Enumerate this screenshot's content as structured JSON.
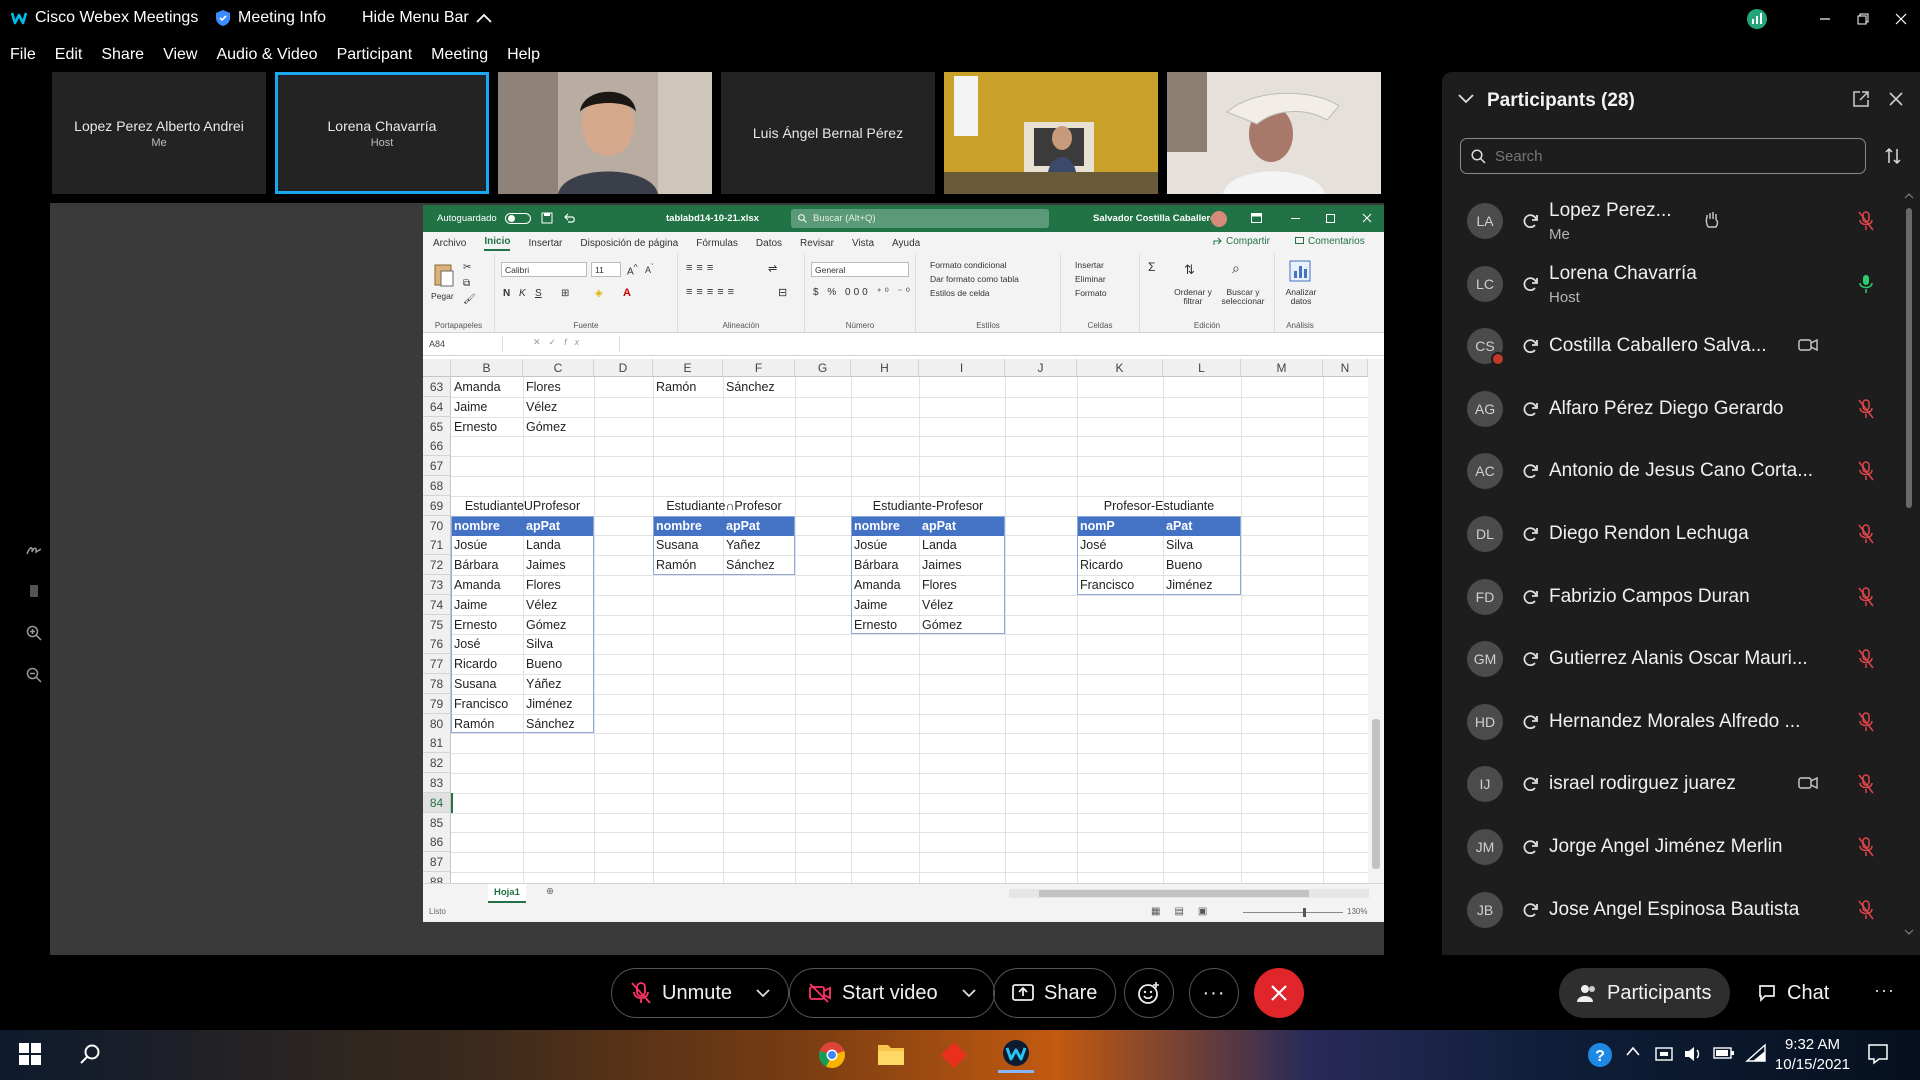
{
  "titlebar": {
    "app_name": "Cisco Webex Meetings",
    "meeting_info": "Meeting Info",
    "hide_menu": "Hide Menu Bar"
  },
  "menu": [
    "File",
    "Edit",
    "Share",
    "View",
    "Audio & Video",
    "Participant",
    "Meeting",
    "Help"
  ],
  "video_tiles": [
    {
      "name": "Lopez Perez Alberto Andrei",
      "sub": "Me"
    },
    {
      "name": "Lorena Chavarría",
      "sub": "Host"
    },
    {
      "name": "Luis Ángel Bernal Pérez",
      "sub": ""
    }
  ],
  "excel": {
    "autosave": "Autoguardado",
    "filename": "tablabd14-10-21.xlsx",
    "search": "Buscar (Alt+Q)",
    "user": "Salvador Costilla Caballero",
    "tabs": [
      "Archivo",
      "Inicio",
      "Insertar",
      "Disposición de página",
      "Fórmulas",
      "Datos",
      "Revisar",
      "Vista",
      "Ayuda"
    ],
    "share": "Compartir",
    "comments": "Comentarios",
    "ribbon": {
      "paste": "Pegar",
      "clipboard": "Portapapeles",
      "font_name": "Calibri",
      "font_size": "11",
      "font": "Fuente",
      "align": "Alineación",
      "num_format": "General",
      "number": "Número",
      "cond_format": "Formato condicional",
      "table_format": "Dar formato como tabla",
      "cell_styles": "Estilos de celda",
      "styles": "Estilos",
      "insert": "Insertar",
      "delete": "Eliminar",
      "format": "Formato",
      "cells": "Celdas",
      "sort": "Ordenar y filtrar",
      "find": "Buscar y seleccionar",
      "editing": "Edición",
      "analyze": "Analizar datos",
      "analysis": "Análisis"
    },
    "namebox": "A84",
    "columns": [
      "B",
      "C",
      "D",
      "E",
      "F",
      "G",
      "H",
      "I",
      "J",
      "K",
      "L",
      "M",
      "N"
    ],
    "rows": [
      "63",
      "64",
      "65",
      "66",
      "67",
      "68",
      "69",
      "70",
      "71",
      "72",
      "73",
      "74",
      "75",
      "76",
      "77",
      "78",
      "79",
      "80",
      "81",
      "82",
      "83",
      "84",
      "85",
      "86",
      "87",
      "88"
    ],
    "selected_row": "84",
    "top_block": [
      [
        "Amanda",
        "Flores"
      ],
      [
        "Jaime",
        "Vélez"
      ],
      [
        "Ernesto",
        "Gómez"
      ]
    ],
    "top_e": [
      "Ramón",
      "Sánchez"
    ],
    "table1": {
      "title": "EstudianteUProfesor",
      "headers": [
        "nombre",
        "apPat"
      ],
      "rows": [
        [
          "Josúe",
          "Landa"
        ],
        [
          "Bárbara",
          "Jaimes"
        ],
        [
          "Amanda",
          "Flores"
        ],
        [
          "Jaime",
          "Vélez"
        ],
        [
          "Ernesto",
          "Gómez"
        ],
        [
          "José",
          "Silva"
        ],
        [
          "Ricardo",
          "Bueno"
        ],
        [
          "Susana",
          "Yáñez"
        ],
        [
          "Francisco",
          "Jiménez"
        ],
        [
          "Ramón",
          "Sánchez"
        ]
      ]
    },
    "table2": {
      "title": "Estudiante∩Profesor",
      "headers": [
        "nombre",
        "apPat"
      ],
      "rows": [
        [
          "Susana",
          "Yañez"
        ],
        [
          "Ramón",
          "Sánchez"
        ]
      ]
    },
    "table3": {
      "title": "Estudiante-Profesor",
      "headers": [
        "nombre",
        "apPat"
      ],
      "rows": [
        [
          "Josúe",
          "Landa"
        ],
        [
          "Bárbara",
          "Jaimes"
        ],
        [
          "Amanda",
          "Flores"
        ],
        [
          "Jaime",
          "Vélez"
        ],
        [
          "Ernesto",
          "Gómez"
        ]
      ]
    },
    "table4": {
      "title": "Profesor-Estudiante",
      "headers": [
        "nomP",
        "aPat"
      ],
      "rows": [
        [
          "José",
          "Silva"
        ],
        [
          "Ricardo",
          "Bueno"
        ],
        [
          "Francisco",
          "Jiménez"
        ]
      ]
    },
    "sheet": "Hoja1",
    "status": "Listo",
    "zoom": "130%"
  },
  "panel": {
    "title": "Participants (28)",
    "search_placeholder": "Search",
    "participants": [
      {
        "initials": "LA",
        "name": "Lopez Perez...",
        "role": "Me",
        "indicator": "mic-off-red",
        "extra": "hand"
      },
      {
        "initials": "LC",
        "name": "Lorena Chavarría",
        "role": "Host",
        "indicator": "mic-on-green",
        "extra": ""
      },
      {
        "initials": "CS",
        "name": "Costilla Caballero Salva...",
        "role": "",
        "indicator": "",
        "extra": "video"
      },
      {
        "initials": "AG",
        "name": "Alfaro Pérez Diego Gerardo",
        "role": "",
        "indicator": "mic-off-red",
        "extra": ""
      },
      {
        "initials": "AC",
        "name": "Antonio de Jesus Cano Corta...",
        "role": "",
        "indicator": "mic-off-red",
        "extra": ""
      },
      {
        "initials": "DL",
        "name": "Diego Rendon Lechuga",
        "role": "",
        "indicator": "mic-off-red",
        "extra": ""
      },
      {
        "initials": "FD",
        "name": "Fabrizio Campos Duran",
        "role": "",
        "indicator": "mic-off-red",
        "extra": ""
      },
      {
        "initials": "GM",
        "name": "Gutierrez Alanis Oscar Mauri...",
        "role": "",
        "indicator": "mic-off-red",
        "extra": ""
      },
      {
        "initials": "HD",
        "name": "Hernandez Morales Alfredo ...",
        "role": "",
        "indicator": "mic-off-red",
        "extra": ""
      },
      {
        "initials": "IJ",
        "name": "israel rodirguez juarez",
        "role": "",
        "indicator": "mic-off-red",
        "extra": "video"
      },
      {
        "initials": "JM",
        "name": "Jorge Angel Jiménez Merlin",
        "role": "",
        "indicator": "mic-off-red",
        "extra": ""
      },
      {
        "initials": "JB",
        "name": "Jose Angel Espinosa Bautista",
        "role": "",
        "indicator": "mic-off-red",
        "extra": ""
      }
    ]
  },
  "controls": {
    "unmute": "Unmute",
    "start_video": "Start video",
    "share": "Share",
    "participants": "Participants",
    "chat": "Chat"
  },
  "taskbar": {
    "time": "9:32 AM",
    "date": "10/15/2021"
  },
  "colors": {
    "accent": "#1aa7ef",
    "end": "#e0252b",
    "excel_green": "#217346",
    "table_header": "#4472c4",
    "muted_red": "#e0454b",
    "mic_green": "#2ecc71"
  }
}
